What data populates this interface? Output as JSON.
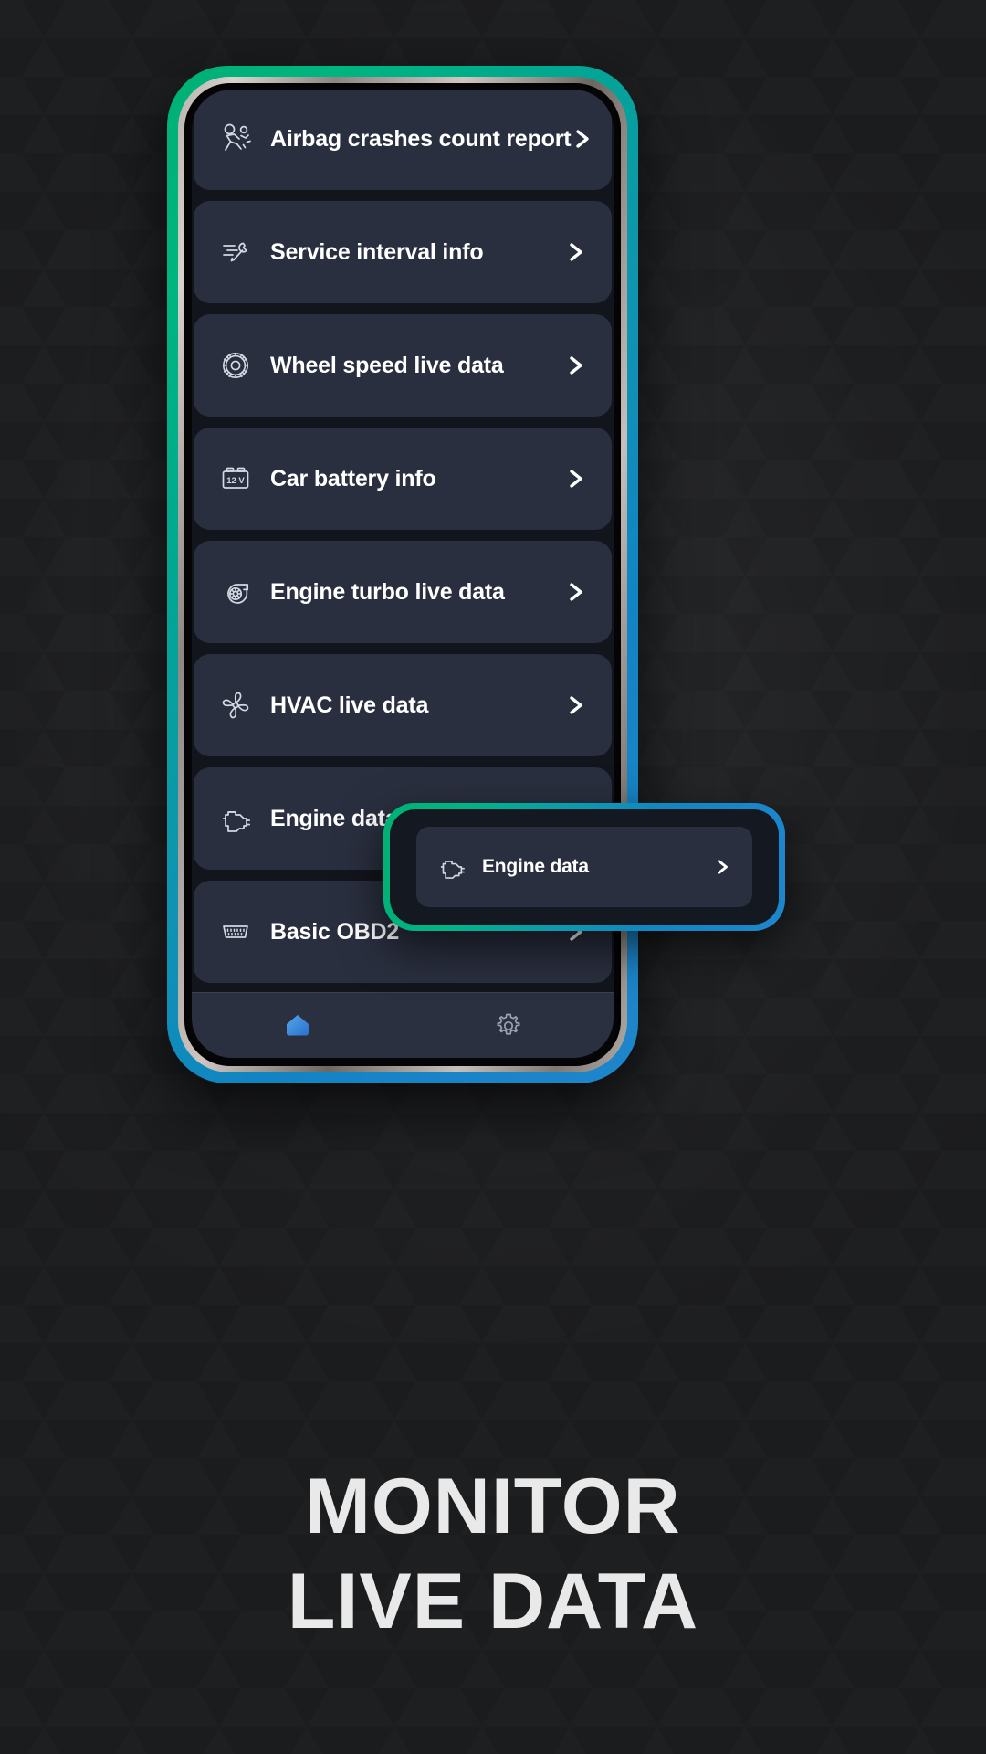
{
  "app": {
    "screen_background": "#12151c",
    "card_background": "#2a2f3f",
    "accent_start": "#00b074",
    "accent_end": "#1e86cc",
    "text_color": "#ffffff"
  },
  "menu": {
    "items": [
      {
        "label": "Airbag crashes count report",
        "icon": "airbag-crash-icon",
        "chevron": "chevron-right-icon"
      },
      {
        "label": "Service interval info",
        "icon": "service-wrench-icon",
        "chevron": "chevron-right-icon"
      },
      {
        "label": "Wheel speed live data",
        "icon": "wheel-speed-icon",
        "chevron": "chevron-right-icon"
      },
      {
        "label": "Car battery info",
        "icon": "car-battery-icon",
        "chevron": "chevron-right-icon",
        "icon_text": "12 V"
      },
      {
        "label": "Engine turbo live data",
        "icon": "turbo-icon",
        "chevron": "chevron-right-icon"
      },
      {
        "label": "HVAC live data",
        "icon": "fan-icon",
        "chevron": "chevron-right-icon"
      },
      {
        "label": "Engine data",
        "icon": "engine-icon",
        "chevron": "chevron-right-icon"
      },
      {
        "label": "Basic OBD2",
        "icon": "obd2-connector-icon",
        "chevron": "chevron-right-icon"
      }
    ]
  },
  "bottom_nav": {
    "items": [
      {
        "name": "home",
        "icon": "home-icon",
        "active": true
      },
      {
        "name": "settings",
        "icon": "gear-icon",
        "active": false
      }
    ]
  },
  "callout": {
    "label": "Engine data",
    "icon": "engine-icon",
    "chevron": "chevron-right-icon"
  },
  "headline": {
    "line1": "MONITOR",
    "line2": "LIVE DATA"
  }
}
